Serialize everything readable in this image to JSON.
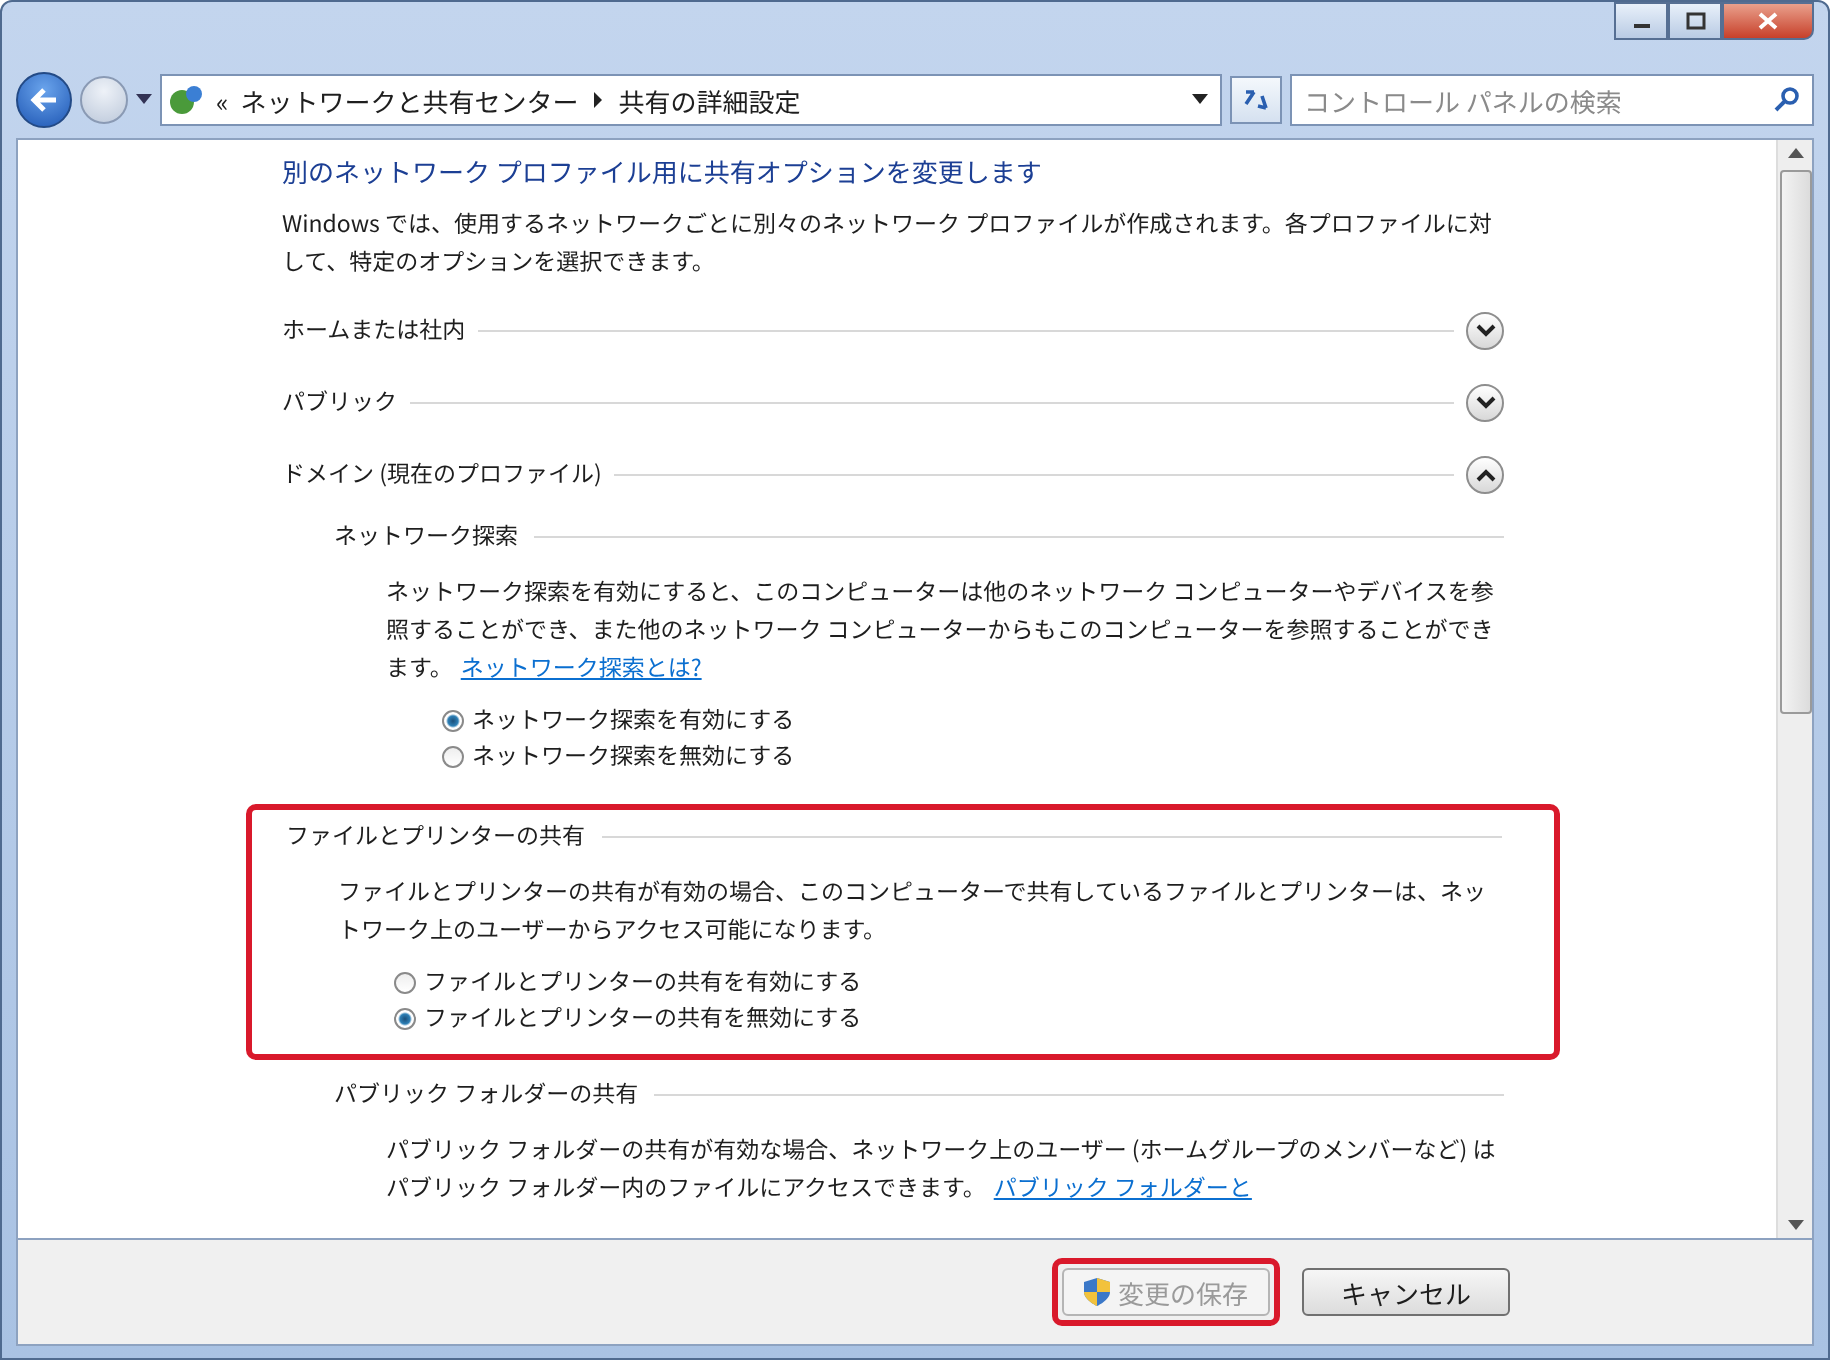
{
  "address_bar": {
    "overflow_mark": "«",
    "breadcrumb": [
      "ネットワークと共有センター",
      "共有の詳細設定"
    ],
    "search": {
      "placeholder": "コントロール パネルの検索"
    }
  },
  "heading": "別のネットワーク プロファイル用に共有オプションを変更します",
  "intro": "Windows では、使用するネットワークごとに別々のネットワーク プロファイルが作成されます。各プロファイルに対して、特定のオプションを選択できます。",
  "profiles": [
    {
      "label": "ホームまたは社内",
      "expanded": false
    },
    {
      "label": "パブリック",
      "expanded": false
    },
    {
      "label": "ドメイン (現在のプロファイル)",
      "expanded": true,
      "sections": [
        {
          "title": "ネットワーク探索",
          "highlighted": false,
          "description": "ネットワーク探索を有効にすると、このコンピューターは他のネットワーク コンピューターやデバイスを参照することができ、また他のネットワーク コンピューターからもこのコンピューターを参照することができます。",
          "link": "ネットワーク探索とは?",
          "options": [
            {
              "label": "ネットワーク探索を有効にする",
              "selected": true
            },
            {
              "label": "ネットワーク探索を無効にする",
              "selected": false
            }
          ]
        },
        {
          "title": "ファイルとプリンターの共有",
          "highlighted": true,
          "description": "ファイルとプリンターの共有が有効の場合、このコンピューターで共有しているファイルとプリンターは、ネットワーク上のユーザーからアクセス可能になります。",
          "options": [
            {
              "label": "ファイルとプリンターの共有を有効にする",
              "selected": false
            },
            {
              "label": "ファイルとプリンターの共有を無効にする",
              "selected": true
            }
          ]
        },
        {
          "title": "パブリック フォルダーの共有",
          "highlighted": false,
          "description": "パブリック フォルダーの共有が有効な場合、ネットワーク上のユーザー (ホームグループのメンバーなど) はパブリック フォルダー内のファイルにアクセスできます。",
          "link": "パブリック フォルダーと"
        }
      ]
    }
  ],
  "buttons": [
    {
      "label": "変更の保存",
      "kind": "shield",
      "disabled": true,
      "highlighted": true
    },
    {
      "label": "キャンセル",
      "kind": "plain",
      "disabled": false,
      "highlighted": false
    }
  ]
}
